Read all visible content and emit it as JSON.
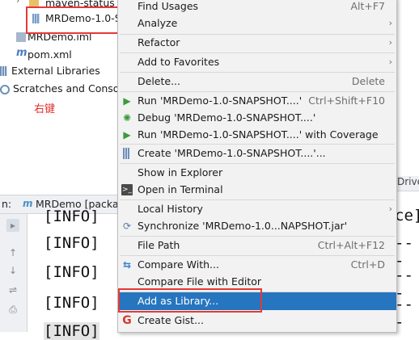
{
  "tree": {
    "rows": [
      {
        "label": "maven-status"
      },
      {
        "label": "MRDemo-1.0-S"
      },
      {
        "label": "MRDemo.iml"
      },
      {
        "label": "pom.xml"
      },
      {
        "label": "External Libraries"
      },
      {
        "label": "Scratches and Console"
      }
    ],
    "annotation": "右键"
  },
  "run_panel": {
    "tab_prefix": "n:",
    "tab_label": "MRDemo [packa",
    "console_lines": [
      "[INFO]",
      "[INFO]",
      "[INFO]",
      "[INFO]",
      "[INFO]"
    ],
    "right_fragments": [
      "ce]",
      "---"
    ]
  },
  "context_menu": {
    "items": [
      {
        "label": "Find Usages",
        "shortcut": "Alt+F7"
      },
      {
        "label": "Analyze",
        "submenu": true
      },
      {
        "label": "Refactor",
        "submenu": true
      },
      {
        "label": "Add to Favorites",
        "submenu": true
      },
      {
        "label": "Delete...",
        "shortcut": "Delete"
      },
      {
        "label": "Run 'MRDemo-1.0-SNAPSHOT....'",
        "shortcut": "Ctrl+Shift+F10",
        "icon": "run-icon"
      },
      {
        "label": "Debug 'MRDemo-1.0-SNAPSHOT....'",
        "icon": "debug-icon"
      },
      {
        "label": "Run 'MRDemo-1.0-SNAPSHOT....' with Coverage",
        "icon": "coverage-icon"
      },
      {
        "label": "Create 'MRDemo-1.0-SNAPSHOT....'...",
        "icon": "config-icon"
      },
      {
        "label": "Show in Explorer"
      },
      {
        "label": "Open in Terminal",
        "icon": "terminal-icon"
      },
      {
        "label": "Local History",
        "submenu": true
      },
      {
        "label": "Synchronize 'MRDemo-1.0...NAPSHOT.jar'",
        "icon": "sync-icon"
      },
      {
        "label": "File Path",
        "shortcut": "Ctrl+Alt+F12"
      },
      {
        "label": "Compare With...",
        "shortcut": "Ctrl+D",
        "icon": "compare-icon"
      },
      {
        "label": "Compare File with Editor"
      },
      {
        "label": "Add as Library...",
        "selected": true
      },
      {
        "label": "Create Gist...",
        "icon": "github-icon"
      }
    ]
  },
  "colors": {
    "menu_bg": "#f2f2f2",
    "selection": "#2675bf",
    "highlight_box": "#e53935",
    "run_green": "#3c9a3c"
  }
}
